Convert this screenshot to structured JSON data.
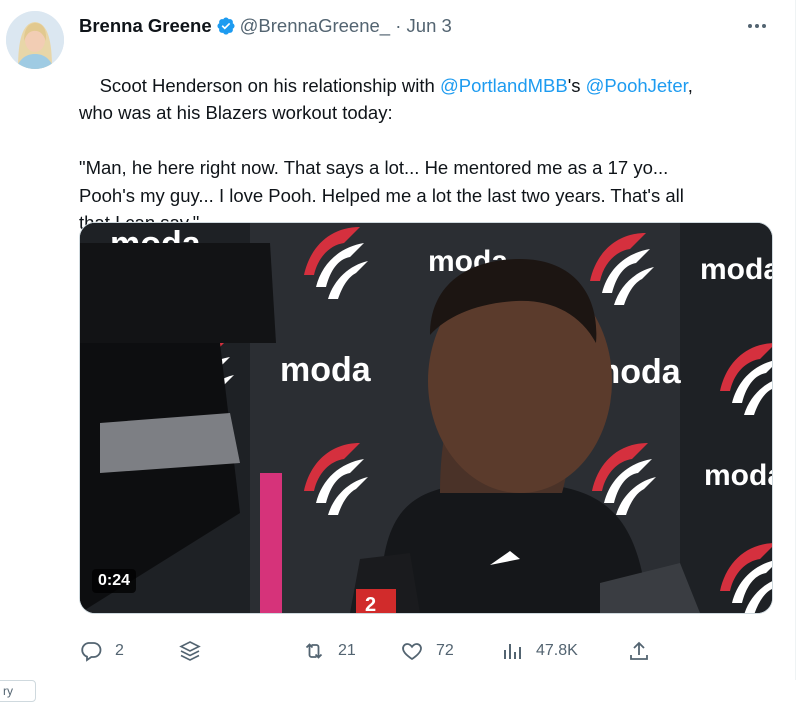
{
  "author": {
    "name": "Brenna Greene",
    "handle": "@BrennaGreene_",
    "separator": "·",
    "date": "Jun 3"
  },
  "tweet": {
    "parts": [
      {
        "type": "text",
        "value": "Scoot Henderson on his relationship with "
      },
      {
        "type": "mention",
        "value": "@PortlandMBB"
      },
      {
        "type": "text",
        "value": "'s "
      },
      {
        "type": "mention",
        "value": "@PoohJeter"
      },
      {
        "type": "text",
        "value": ",\nwho was at his Blazers workout today:\n\n\"Man, he here right now. That says a lot... He mentored me as a 17 yo...\nPooh's my guy... I love Pooh. Helped me a lot the last two years. That's all\nthat I can say.\""
      }
    ]
  },
  "media": {
    "duration": "0:24",
    "backdrop_text": "moda",
    "badge_number": "2"
  },
  "actions": {
    "reply_count": "2",
    "retweet_count": "21",
    "like_count": "72",
    "views_count": "47.8K"
  },
  "side_fragment": "ry",
  "colors": {
    "link": "#1d9bf0",
    "muted": "#536471",
    "verified": "#1d9bf0",
    "text": "#0f1419"
  }
}
